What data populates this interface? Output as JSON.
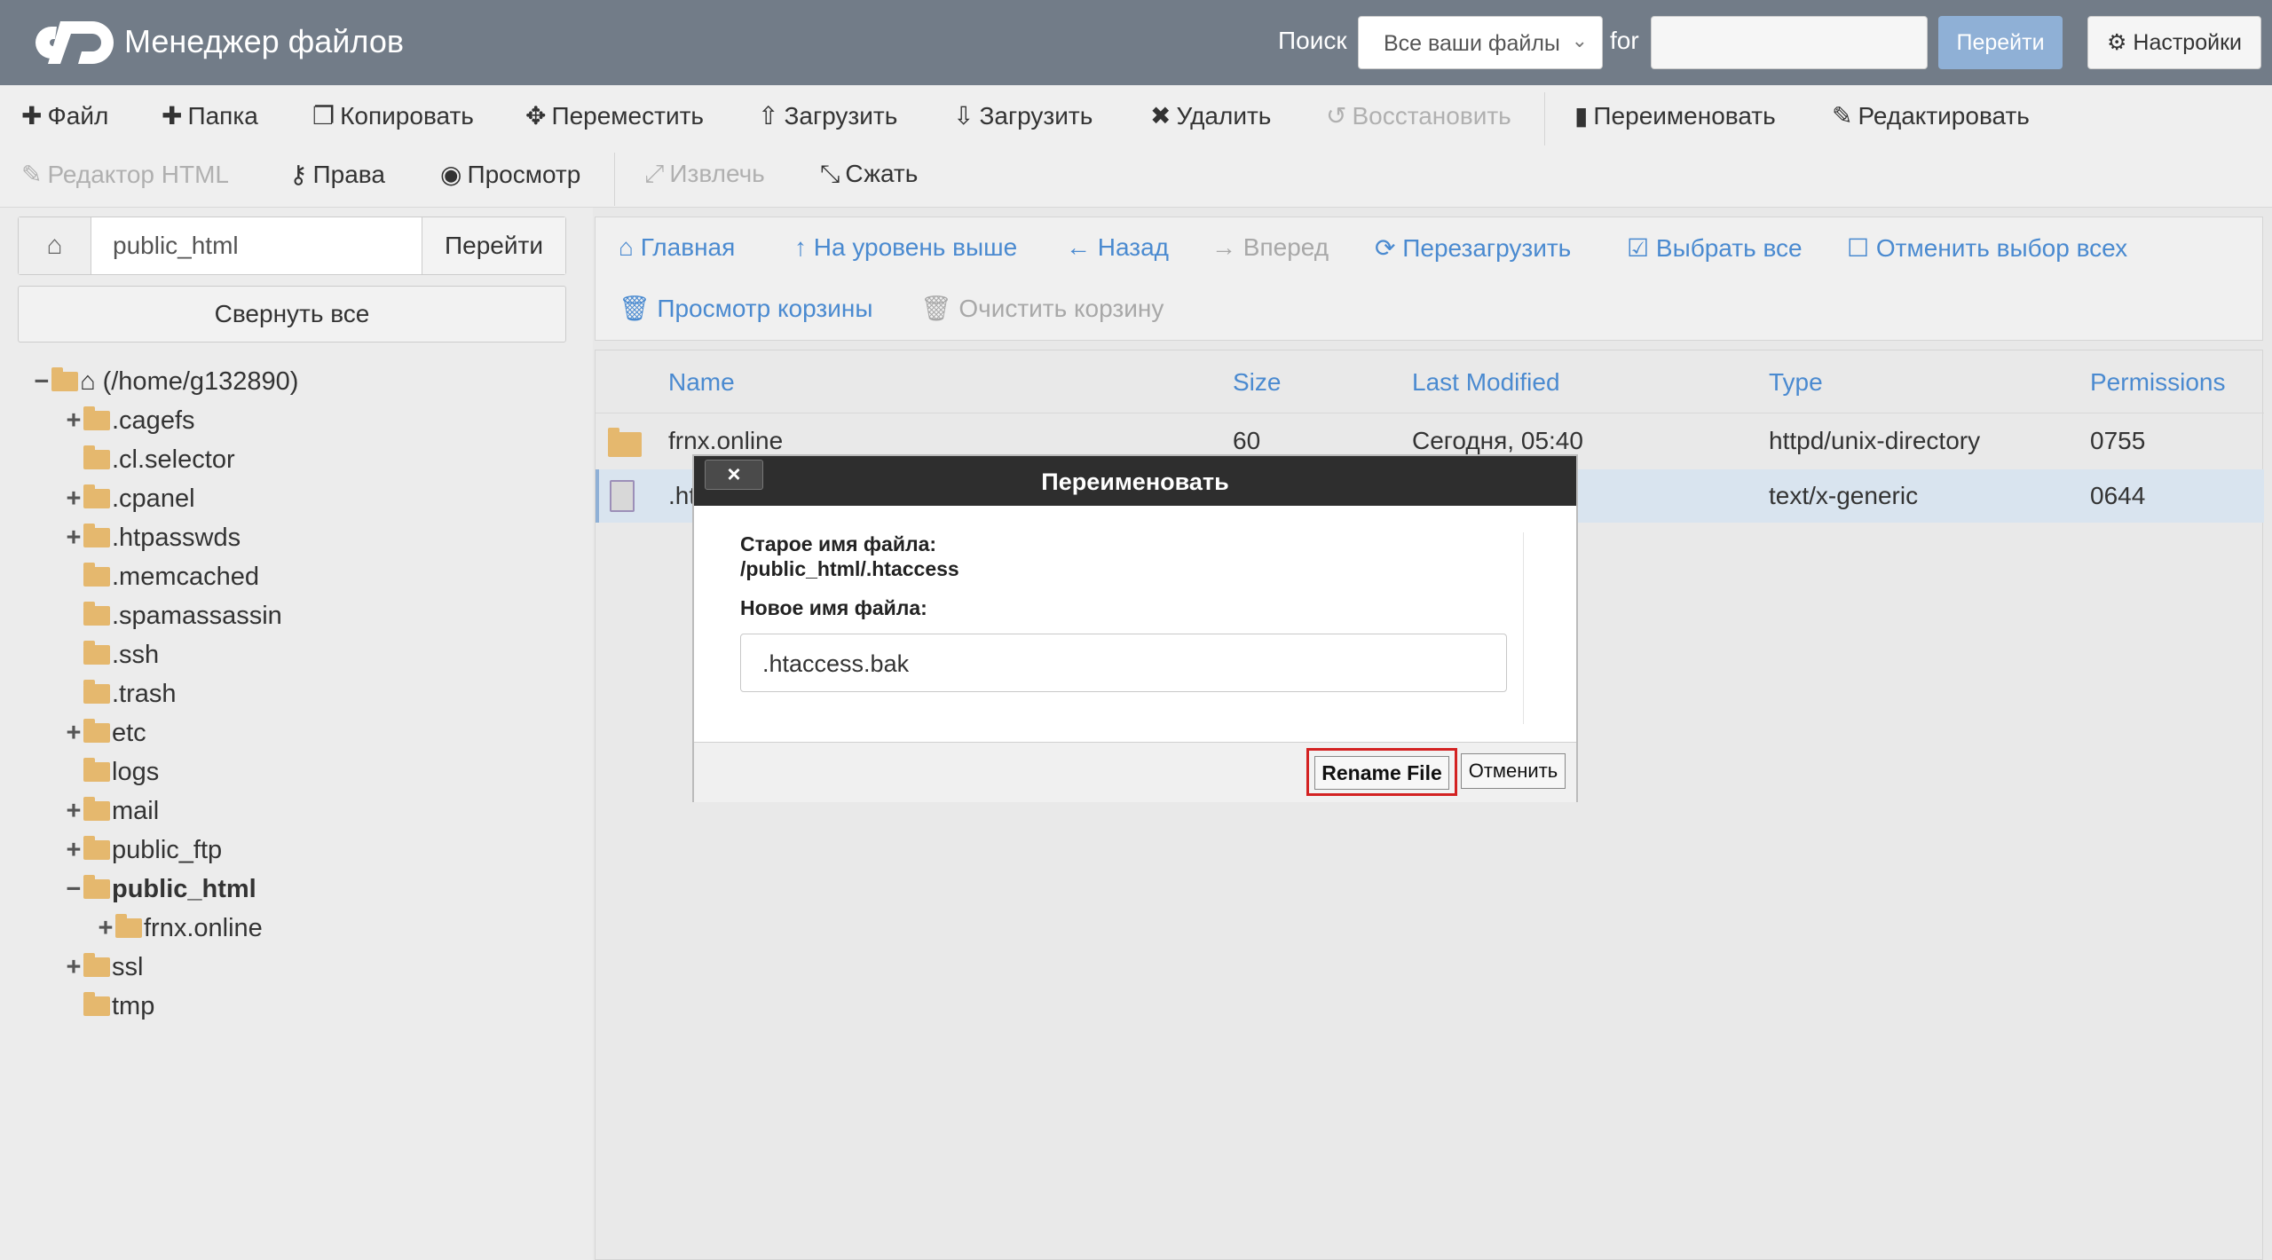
{
  "header": {
    "app_title": "Менеджер файлов",
    "search_label": "Поиск",
    "search_scope": "Все ваши файлы",
    "for_label": "for",
    "search_value": "",
    "go_label": "Перейти",
    "settings_label": "Настройки"
  },
  "toolbar": {
    "file": "Файл",
    "folder": "Папка",
    "copy": "Копировать",
    "move": "Переместить",
    "upload": "Загрузить",
    "download": "Загрузить",
    "delete": "Удалить",
    "restore": "Восстановить",
    "rename": "Переименовать",
    "edit": "Редактировать",
    "html_editor": "Редактор HTML",
    "permissions": "Права",
    "view": "Просмотр",
    "extract": "Извлечь",
    "compress": "Сжать"
  },
  "sidebar": {
    "path_value": "public_html",
    "go_label": "Перейти",
    "collapse_label": "Свернуть все",
    "tree": [
      {
        "label": "(/home/g132890)",
        "toggle": "−"
      },
      {
        "label": ".cagefs",
        "toggle": "+"
      },
      {
        "label": ".cl.selector",
        "toggle": ""
      },
      {
        "label": ".cpanel",
        "toggle": "+"
      },
      {
        "label": ".htpasswds",
        "toggle": "+"
      },
      {
        "label": ".memcached",
        "toggle": ""
      },
      {
        "label": ".spamassassin",
        "toggle": ""
      },
      {
        "label": ".ssh",
        "toggle": ""
      },
      {
        "label": ".trash",
        "toggle": ""
      },
      {
        "label": "etc",
        "toggle": "+"
      },
      {
        "label": "logs",
        "toggle": ""
      },
      {
        "label": "mail",
        "toggle": "+"
      },
      {
        "label": "public_ftp",
        "toggle": "+"
      },
      {
        "label": "public_html",
        "toggle": "−"
      },
      {
        "label": "frnx.online",
        "toggle": "+"
      },
      {
        "label": "ssl",
        "toggle": "+"
      },
      {
        "label": "tmp",
        "toggle": ""
      }
    ]
  },
  "nav": {
    "home": "Главная",
    "up": "На уровень выше",
    "back": "Назад",
    "forward": "Вперед",
    "reload": "Перезагрузить",
    "select_all": "Выбрать все",
    "unselect_all": "Отменить выбор всех",
    "view_trash": "Просмотр корзины",
    "empty_trash": "Очистить корзину"
  },
  "table": {
    "columns": [
      "Name",
      "Size",
      "Last Modified",
      "Type",
      "Permissions"
    ],
    "rows": [
      {
        "name": "frnx.online",
        "size": "60",
        "modified": "Сегодня, 05:40",
        "type": "httpd/unix-directory",
        "perms": "0755"
      },
      {
        "name": ".ht",
        "size": "",
        "modified": "",
        "type": "text/x-generic",
        "perms": "0644"
      }
    ]
  },
  "modal": {
    "title": "Переименовать",
    "close": "×",
    "old_name_label": "Старое имя файла:",
    "old_name_value": "/public_html/.htaccess",
    "new_name_label": "Новое имя файла:",
    "new_name_value": ".htaccess.bak",
    "rename_button": "Rename File",
    "cancel_button": "Отменить"
  }
}
